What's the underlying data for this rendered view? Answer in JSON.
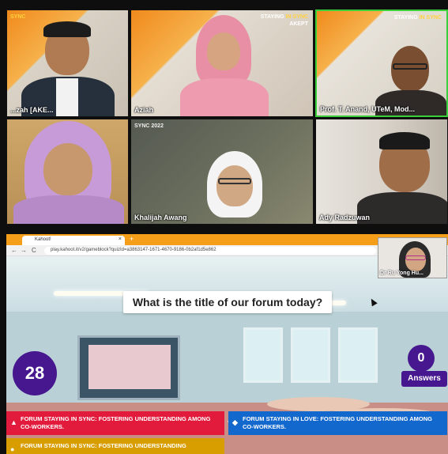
{
  "meeting": {
    "tiles": [
      {
        "name": "...zah [AKE...",
        "banner_prefix": "",
        "banner_highlight": "SYNC"
      },
      {
        "name": "Aziah",
        "banner_prefix": "STAYING",
        "banner_highlight": "IN SYNC",
        "banner_sub": "AKEPT"
      },
      {
        "name": "Prof. T. Anand, UTeM, Mod...",
        "banner_prefix": "STAYING",
        "banner_highlight": "IN SYNC"
      },
      {
        "name": ""
      },
      {
        "name": "Khalijah Awang",
        "banner_prefix": "",
        "banner_highlight": "SYNC 2022"
      },
      {
        "name": "Ady Radzuwan"
      }
    ],
    "presenter_pip_name": "Dr Ru Yong Hu..."
  },
  "browser": {
    "tab_title": "Kahoot!",
    "tab_close": "×",
    "new_tab": "+",
    "back": "←",
    "forward": "→",
    "reload": "C",
    "url": "play.kahoot.it/v2/gameblock?quizId=a3863147-1671-4670-9186-0b2af1d5e862"
  },
  "kahoot": {
    "question": "What is the title of our forum today?",
    "timer": "28",
    "answers_count": "0",
    "answers_label": "Answers",
    "options": [
      {
        "shape": "▲",
        "text": "FORUM STAYING IN SYNC: FOSTERING UNDERSTANDING AMONG CO-WORKERS."
      },
      {
        "shape": "◆",
        "text": "FORUM STAYING IN LOVE: FOSTERING UNDERSTANDING AMONG CO-WORKERS."
      },
      {
        "shape": "●",
        "text": "FORUM STAYING IN SYNC: FOSTERING UNDERSTANDING"
      },
      {
        "shape": "■",
        "text": ""
      }
    ]
  },
  "colors": {
    "kahoot_purple": "#46178f",
    "answer_red": "#e21b3c",
    "answer_blue": "#1368ce",
    "answer_yellow": "#d89e00",
    "active_speaker": "#3ccf3c"
  }
}
